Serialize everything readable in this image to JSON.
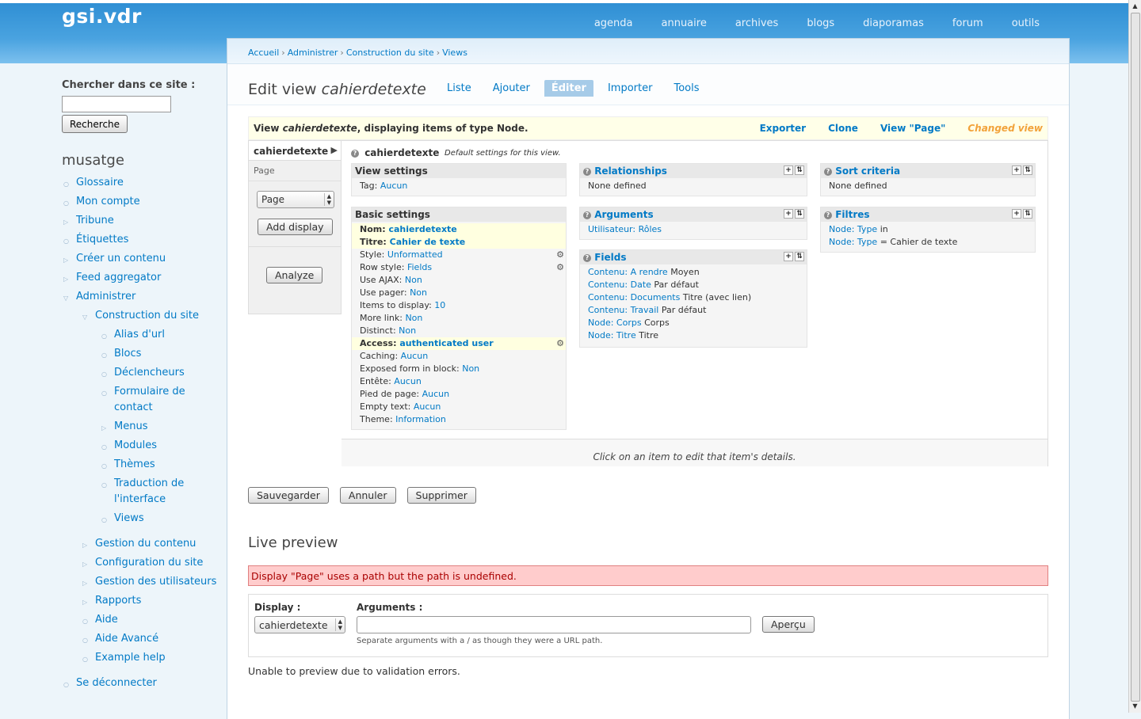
{
  "site_name": "gsi.vdr",
  "primary_links": [
    "agenda",
    "annuaire",
    "archives",
    "blogs",
    "diaporamas",
    "forum",
    "outils"
  ],
  "sidebar": {
    "search_label": "Chercher dans ce site :",
    "search_value": "",
    "search_button": "Recherche",
    "user_name": "musatge",
    "nav": [
      {
        "label": "Glossaire",
        "level": 1,
        "bullet": "leaf"
      },
      {
        "label": "Mon compte",
        "level": 1,
        "bullet": "leaf"
      },
      {
        "label": "Tribune",
        "level": 1,
        "bullet": "collapsed"
      },
      {
        "label": "Étiquettes",
        "level": 1,
        "bullet": "leaf"
      },
      {
        "label": "Créer un contenu",
        "level": 1,
        "bullet": "collapsed"
      },
      {
        "label": "Feed aggregator",
        "level": 1,
        "bullet": "collapsed"
      },
      {
        "label": "Administrer",
        "level": 1,
        "bullet": "expanded"
      },
      {
        "label": "Construction du site",
        "level": 2,
        "bullet": "expanded"
      },
      {
        "label": "Alias d'url",
        "level": 3,
        "bullet": "leaf"
      },
      {
        "label": "Blocs",
        "level": 3,
        "bullet": "leaf"
      },
      {
        "label": "Déclencheurs",
        "level": 3,
        "bullet": "leaf"
      },
      {
        "label": "Formulaire de contact",
        "level": 3,
        "bullet": "leaf"
      },
      {
        "label": "Menus",
        "level": 3,
        "bullet": "collapsed"
      },
      {
        "label": "Modules",
        "level": 3,
        "bullet": "leaf"
      },
      {
        "label": "Thèmes",
        "level": 3,
        "bullet": "leaf"
      },
      {
        "label": "Traduction de l'interface",
        "level": 3,
        "bullet": "leaf"
      },
      {
        "label": "Views",
        "level": 3,
        "bullet": "leaf"
      },
      {
        "label": "Gestion du contenu",
        "level": 2,
        "bullet": "collapsed"
      },
      {
        "label": "Configuration du site",
        "level": 2,
        "bullet": "collapsed"
      },
      {
        "label": "Gestion des utilisateurs",
        "level": 2,
        "bullet": "collapsed"
      },
      {
        "label": "Rapports",
        "level": 2,
        "bullet": "collapsed"
      },
      {
        "label": "Aide",
        "level": 2,
        "bullet": "leaf"
      },
      {
        "label": "Aide Avancé",
        "level": 2,
        "bullet": "leaf"
      },
      {
        "label": "Example help",
        "level": 2,
        "bullet": "leaf"
      },
      {
        "label": "Se déconnecter",
        "level": 1,
        "bullet": "leaf"
      }
    ]
  },
  "breadcrumb": [
    "Accueil",
    "Administrer",
    "Construction du site",
    "Views"
  ],
  "title": {
    "prefix": "Edit view",
    "name": "cahierdetexte"
  },
  "tabs": [
    {
      "label": "Liste",
      "active": false
    },
    {
      "label": "Ajouter",
      "active": false
    },
    {
      "label": "Éditer",
      "active": true
    },
    {
      "label": "Importer",
      "active": false
    },
    {
      "label": "Tools",
      "active": false
    }
  ],
  "view_header": {
    "prefix": "View",
    "name": "cahierdetexte",
    "suffix": ", displaying items of type Node.",
    "links": [
      "Exporter",
      "Clone",
      "View \"Page\""
    ],
    "changed": "Changed view"
  },
  "displays": {
    "default_tab": "cahierdetexte",
    "page_tab": "Page",
    "select_value": "Page",
    "add_button": "Add display",
    "analyze_button": "Analyze"
  },
  "default_display": {
    "title": "cahierdetexte",
    "desc": "Default settings for this view."
  },
  "view_settings": {
    "title": "View settings",
    "rows": [
      {
        "label": "Tag:",
        "value": "Aucun"
      }
    ]
  },
  "basic_settings": {
    "title": "Basic settings",
    "rows": [
      {
        "label": "Nom:",
        "value": "cahierdetexte",
        "hl": true,
        "gear": false
      },
      {
        "label": "Titre:",
        "value": "Cahier de texte",
        "hl": true,
        "gear": false
      },
      {
        "label": "Style:",
        "value": "Unformatted",
        "hl": false,
        "gear": true
      },
      {
        "label": "Row style:",
        "value": "Fields",
        "hl": false,
        "gear": true
      },
      {
        "label": "Use AJAX:",
        "value": "Non",
        "hl": false,
        "gear": false
      },
      {
        "label": "Use pager:",
        "value": "Non",
        "hl": false,
        "gear": false
      },
      {
        "label": "Items to display:",
        "value": "10",
        "hl": false,
        "gear": false
      },
      {
        "label": "More link:",
        "value": "Non",
        "hl": false,
        "gear": false
      },
      {
        "label": "Distinct:",
        "value": "Non",
        "hl": false,
        "gear": false
      },
      {
        "label": "Access:",
        "value": "authenticated user",
        "hl": true,
        "gear": true
      },
      {
        "label": "Caching:",
        "value": "Aucun",
        "hl": false,
        "gear": false
      },
      {
        "label": "Exposed form in block:",
        "value": "Non",
        "hl": false,
        "gear": false
      },
      {
        "label": "Entête:",
        "value": "Aucun",
        "hl": false,
        "gear": false
      },
      {
        "label": "Pied de page:",
        "value": "Aucun",
        "hl": false,
        "gear": false
      },
      {
        "label": "Empty text:",
        "value": "Aucun",
        "hl": false,
        "gear": false
      },
      {
        "label": "Theme:",
        "value": "Information",
        "hl": false,
        "gear": false
      }
    ]
  },
  "relationships": {
    "title": "Relationships",
    "empty": "None defined"
  },
  "arguments": {
    "title": "Arguments",
    "rows": [
      {
        "link": "Utilisateur: Rôles",
        "text": ""
      }
    ]
  },
  "fields": {
    "title": "Fields",
    "rows": [
      {
        "group": "Contenu:",
        "field": "A rendre",
        "text": "Moyen"
      },
      {
        "group": "Contenu:",
        "field": "Date",
        "text": "Par défaut"
      },
      {
        "group": "Contenu:",
        "field": "Documents",
        "text": "Titre (avec lien)"
      },
      {
        "group": "Contenu:",
        "field": "Travail",
        "text": "Par défaut"
      },
      {
        "group": "Node:",
        "field": "Corps",
        "text": "Corps"
      },
      {
        "group": "Node:",
        "field": "Titre",
        "text": "Titre"
      }
    ]
  },
  "sort_criteria": {
    "title": "Sort criteria",
    "empty": "None defined"
  },
  "filters": {
    "title": "Filtres",
    "rows": [
      {
        "group": "Node:",
        "field": "Type",
        "text": "in"
      },
      {
        "group": "Node:",
        "field": "Type",
        "text": "= Cahier de texte"
      }
    ]
  },
  "click_hint": "Click on an item to edit that item's details.",
  "actions": [
    "Sauvegarder",
    "Annuler",
    "Supprimer"
  ],
  "live_preview": {
    "title": "Live preview",
    "error": "Display \"Page\" uses a path but the path is undefined.",
    "display_label": "Display :",
    "display_value": "cahierdetexte",
    "args_label": "Arguments :",
    "args_value": "",
    "args_help": "Separate arguments with a / as though they were a URL path.",
    "preview_button": "Aperçu",
    "no_preview": "Unable to preview due to validation errors."
  },
  "icons": {
    "help": "help-icon",
    "add": "add-icon",
    "rearrange": "rearrange-icon",
    "gear": "gear-icon"
  }
}
